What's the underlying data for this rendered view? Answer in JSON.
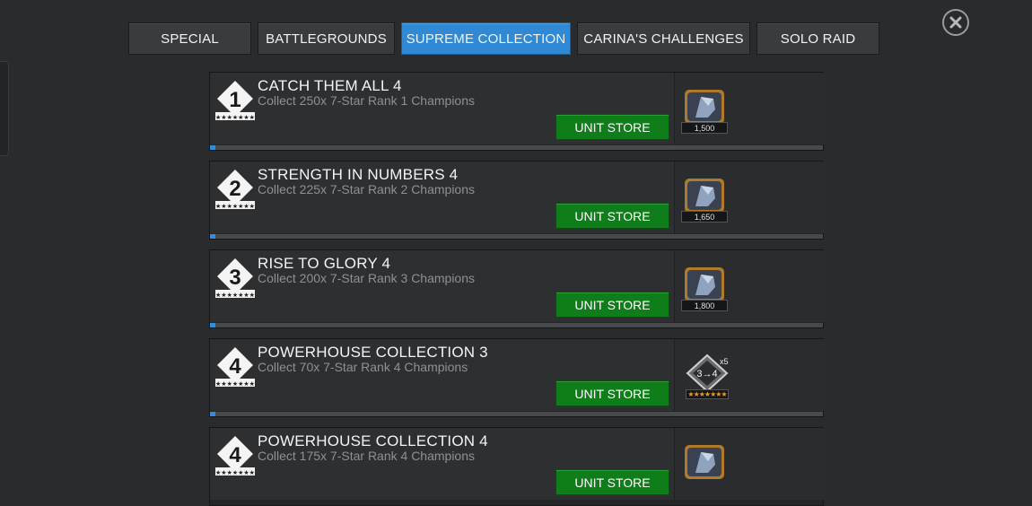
{
  "tabs": [
    {
      "label": "SPECIAL"
    },
    {
      "label": "BATTLEGROUNDS"
    },
    {
      "label": "SUPREME COLLECTION"
    },
    {
      "label": "CARINA'S CHALLENGES"
    },
    {
      "label": "SOLO RAID"
    }
  ],
  "active_tab": "SUPREME COLLECTION",
  "colors": {
    "accent": "#2f89d4",
    "button_green": "#0f7d19",
    "progress": "#2f8ee0",
    "star_gold": "#e69a2e"
  },
  "icons": {
    "close": "close-icon",
    "tier_badge": "diamond-number-badge-icon",
    "crystal": "crystal-shard-icon",
    "rank_up": "rank-up-gem-icon"
  },
  "objectives": [
    {
      "number": "1",
      "title": "CATCH THEM ALL 4",
      "description": "Collect 250x 7-Star Rank 1 Champions",
      "button_label": "UNIT STORE",
      "reward_amount": "1,500",
      "progress_fraction": 0.01
    },
    {
      "number": "2",
      "title": "STRENGTH IN NUMBERS 4",
      "description": "Collect 225x 7-Star Rank 2 Champions",
      "button_label": "UNIT STORE",
      "reward_amount": "1,650",
      "progress_fraction": 0.01
    },
    {
      "number": "3",
      "title": "RISE TO GLORY 4",
      "description": "Collect 200x 7-Star Rank 3 Champions",
      "button_label": "UNIT STORE",
      "reward_amount": "1,800",
      "progress_fraction": 0.01
    },
    {
      "number": "4",
      "title": "POWERHOUSE COLLECTION 3",
      "description": "Collect 70x 7-Star Rank 4 Champions",
      "button_label": "UNIT STORE",
      "reward_label": "3→4",
      "reward_multiplier": "x5",
      "reward_stars": "★★★★★★★",
      "progress_fraction": 0.01
    },
    {
      "number": "4",
      "title": "POWERHOUSE COLLECTION 4",
      "description": "Collect 175x 7-Star Rank 4 Champions",
      "button_label": "UNIT STORE",
      "progress_fraction": 0.01
    }
  ]
}
